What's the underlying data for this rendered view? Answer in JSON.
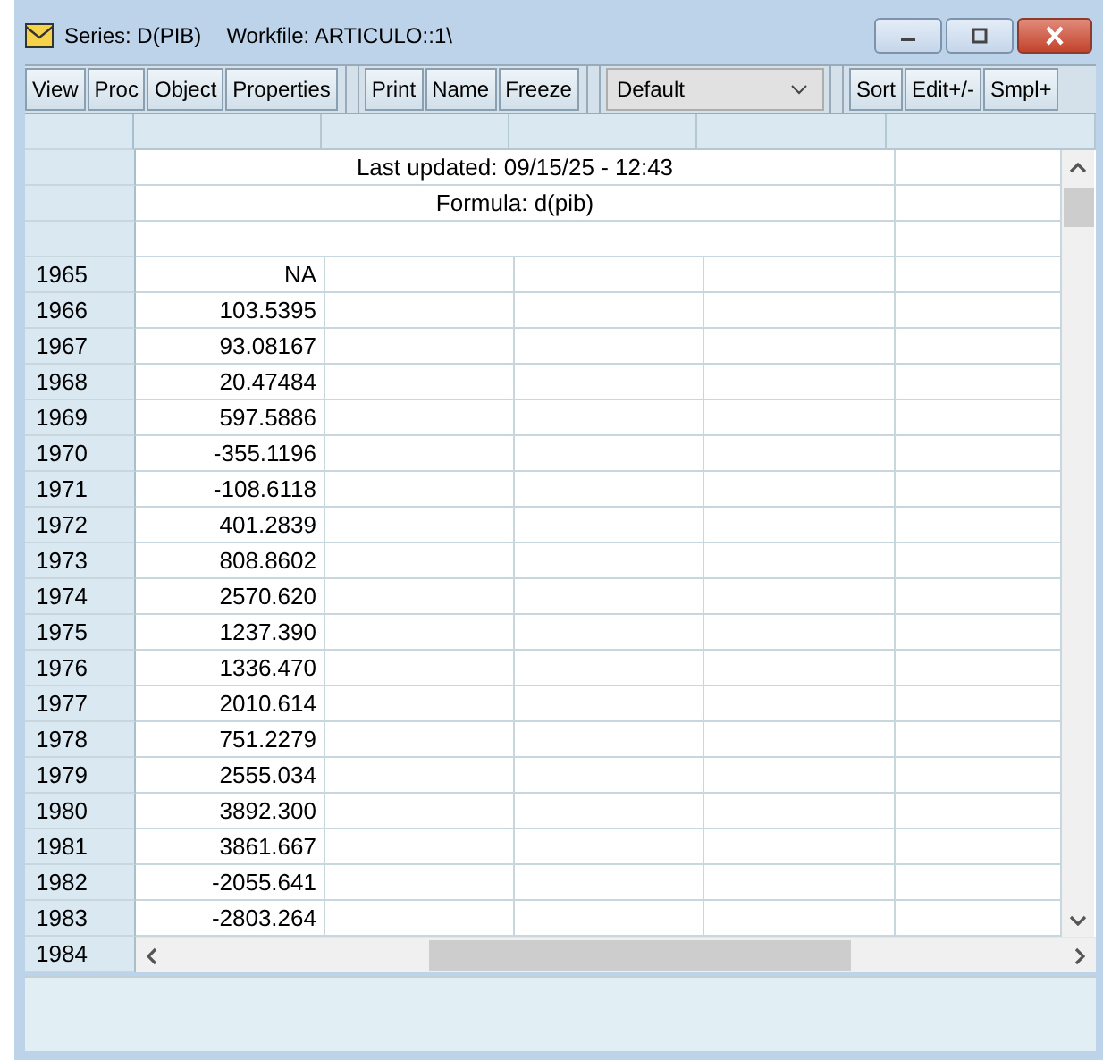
{
  "window": {
    "title": "Series: D(PIB)",
    "workfile": "Workfile: ARTICULO::1\\"
  },
  "toolbar": {
    "groups": [
      [
        "View",
        "Proc",
        "Object",
        "Properties"
      ],
      [
        "Print",
        "Name",
        "Freeze"
      ]
    ],
    "dropdown": {
      "value": "Default"
    },
    "after": [
      "Sort",
      "Edit+/-",
      "Smpl+"
    ]
  },
  "sheet": {
    "info": [
      "Last updated: 09/15/25 - 12:43",
      "Formula: d(pib)"
    ],
    "rows": [
      {
        "label": "1965",
        "value": "NA"
      },
      {
        "label": "1966",
        "value": "103.5395"
      },
      {
        "label": "1967",
        "value": "93.08167"
      },
      {
        "label": "1968",
        "value": "20.47484"
      },
      {
        "label": "1969",
        "value": "597.5886"
      },
      {
        "label": "1970",
        "value": "-355.1196"
      },
      {
        "label": "1971",
        "value": "-108.6118"
      },
      {
        "label": "1972",
        "value": "401.2839"
      },
      {
        "label": "1973",
        "value": "808.8602"
      },
      {
        "label": "1974",
        "value": "2570.620"
      },
      {
        "label": "1975",
        "value": "1237.390"
      },
      {
        "label": "1976",
        "value": "1336.470"
      },
      {
        "label": "1977",
        "value": "2010.614"
      },
      {
        "label": "1978",
        "value": "751.2279"
      },
      {
        "label": "1979",
        "value": "2555.034"
      },
      {
        "label": "1980",
        "value": "3892.300"
      },
      {
        "label": "1981",
        "value": "3861.667"
      },
      {
        "label": "1982",
        "value": "-2055.641"
      },
      {
        "label": "1983",
        "value": "-2803.264"
      }
    ],
    "last_row_label": "1984"
  }
}
